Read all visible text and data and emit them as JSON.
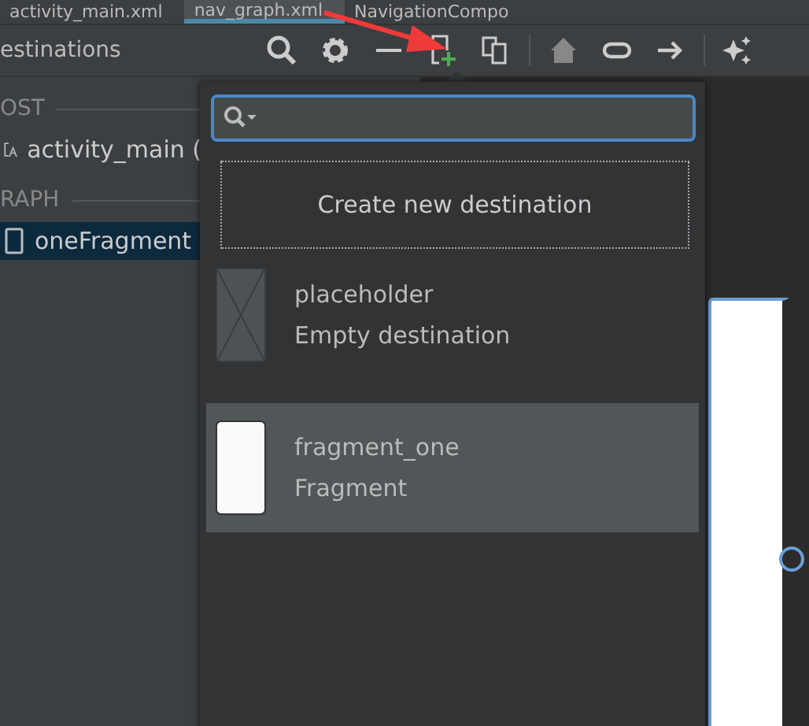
{
  "editor_tabs": [
    {
      "label": "activity_main.xml",
      "selected": false
    },
    {
      "label": "nav_graph.xml",
      "selected": true
    },
    {
      "label": "NavigationCompo",
      "selected": false
    }
  ],
  "panel": {
    "title": "estinations"
  },
  "sections": [
    {
      "header": "OST",
      "items": [
        {
          "label": "activity_main (",
          "kind": "activity",
          "selected": false
        }
      ]
    },
    {
      "header": "RAPH",
      "items": [
        {
          "label": "oneFragment",
          "kind": "fragment",
          "selected": true
        }
      ]
    }
  ],
  "popup": {
    "create_label": "Create new destination",
    "destinations": [
      {
        "name": "placeholder",
        "type": "Empty destination",
        "kind": "placeholder",
        "selected": false
      },
      {
        "name": "fragment_one",
        "type": "Fragment",
        "kind": "fragment",
        "selected": true
      }
    ]
  }
}
